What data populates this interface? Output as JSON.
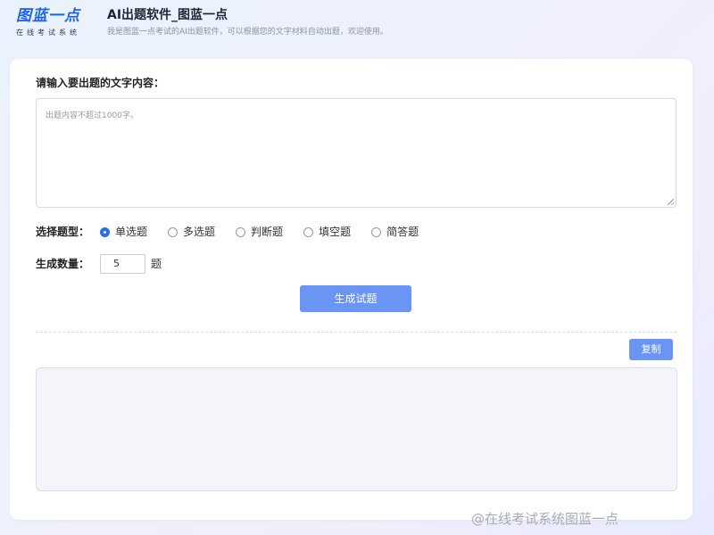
{
  "header": {
    "logo_title": "图蓝一点",
    "logo_subtitle": "在线考试系统",
    "app_title": "AI出题软件_图蓝一点",
    "app_description": "我是图蓝一点考试的AI出题软件，可以根据您的文字材料自动出题，欢迎使用。"
  },
  "form": {
    "input_label": "请输入要出题的文字内容：",
    "textarea_placeholder": "出题内容不超过1000字。",
    "question_type_label": "选择题型：",
    "question_types": [
      {
        "label": "单选题",
        "selected": true
      },
      {
        "label": "多选题",
        "selected": false
      },
      {
        "label": "判断题",
        "selected": false
      },
      {
        "label": "填空题",
        "selected": false
      },
      {
        "label": "简答题",
        "selected": false
      }
    ],
    "count_label": "生成数量：",
    "count_value": "5",
    "count_unit": "题",
    "generate_label": "生成试题"
  },
  "result": {
    "copy_label": "复制",
    "content": ""
  },
  "watermark": "@在线考试系统图蓝一点",
  "colors": {
    "accent": "#2b6fe6",
    "button": "#6a95f2",
    "logo": "#1f63e6"
  }
}
